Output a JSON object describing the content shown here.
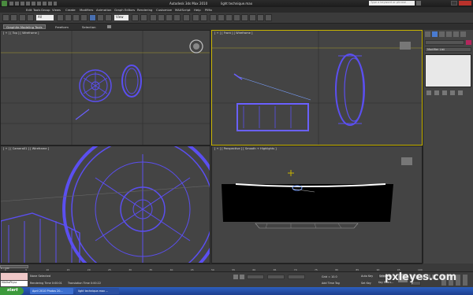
{
  "title_bar": {
    "app_title": "Autodesk 3ds Max 2010",
    "file_name": "light technique.max",
    "search_placeholder": "Type a keyword or phrase"
  },
  "menu": [
    "Edit",
    "Tools",
    "Group",
    "Views",
    "Create",
    "Modifiers",
    "Animation",
    "Graph Editors",
    "Rendering",
    "Customize",
    "MAXScript",
    "Help",
    "PiMa"
  ],
  "toolbar": {
    "selection_filter": "All",
    "reference_dropdown": "View"
  },
  "ribbon": {
    "title": "Graphite Modeling Tools",
    "tabs": [
      "Freeform",
      "Selection"
    ]
  },
  "viewports": {
    "top": "[ + ] [ Top ] [ Wireframe ]",
    "front": "[ + ] [ Front ] [ Wireframe ]",
    "camera": "[ + ] [ Camera01 ] [ Wireframe ]",
    "perspective": "[ + ] [ Perspective ] [ Smooth + Highlights ]"
  },
  "command_panel": {
    "modifier_list": "Modifier List"
  },
  "timeline": {
    "frame_counter": "0 / 100",
    "ticks": [
      "0",
      "5",
      "10",
      "15",
      "20",
      "25",
      "30",
      "35",
      "40",
      "45",
      "50",
      "55",
      "60",
      "65",
      "70",
      "75",
      "80",
      "85",
      "90",
      "95",
      "100"
    ]
  },
  "status": {
    "selection": "None Selected",
    "rendering_time": "Rendering Time  0:00:01",
    "translation_time": "Translation Time  0:00:22",
    "max_to_physc": "MAXtoPhysc",
    "grid": "Grid = 10.0",
    "add_time_tag": "Add Time Tag",
    "auto_key": "Auto Key",
    "set_key": "Set Key",
    "selected": "Selected",
    "key_filters": "Key Filters...",
    "frame": "0"
  },
  "taskbar": {
    "start": "start",
    "item1": "April 2010 Photos 20...",
    "item2": "light technique.max ..."
  },
  "watermark": "pxleyes.com",
  "colors": {
    "wire": "#5b4ff0",
    "active_border": "#c8b400",
    "viewport_bg": "#444444"
  }
}
